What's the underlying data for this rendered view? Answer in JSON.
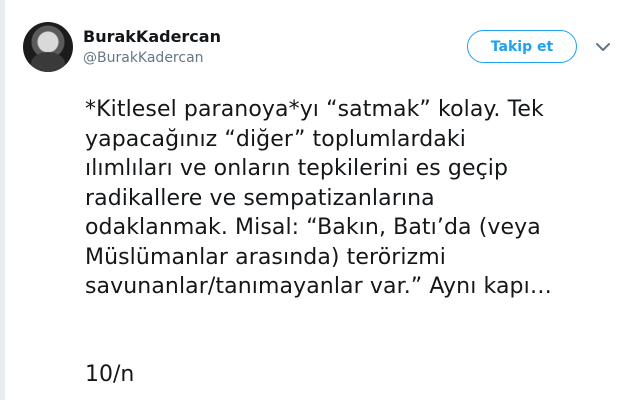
{
  "author": {
    "display_name": "BurakKadercan",
    "handle": "@BurakKadercan"
  },
  "actions": {
    "follow_label": "Takip et",
    "menu_icon": "chevron-down-icon"
  },
  "tweet": {
    "text": "*Kitlesel paranoya*yı “satmak” kolay. Tek\nyapacağınız “diğer” toplumlardaki\nılımlıları ve onların tepkilerini es geçip\nradikallere ve sempatizanlarına\nodaklanmak. Misal: “Bakın, Batı’da (veya\nMüslümanlar arasında) terörizmi\nsavunanlar/tanımayanlar var.” Aynı kapı…",
    "thread_count": "10/n"
  },
  "colors": {
    "accent": "#1da1f2",
    "secondary_text": "#657786",
    "thread_line": "#e6ecf0"
  }
}
